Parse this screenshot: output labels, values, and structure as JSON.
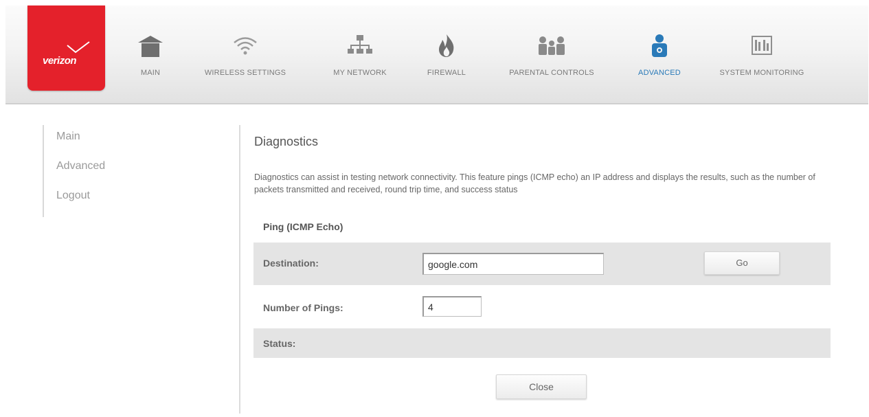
{
  "brand": {
    "logo_text": "verizon",
    "color": "#e4212b"
  },
  "nav": {
    "items": [
      {
        "label": "MAIN",
        "icon": "home-icon"
      },
      {
        "label": "WIRELESS SETTINGS",
        "icon": "wifi-icon"
      },
      {
        "label": "MY NETWORK",
        "icon": "network-icon"
      },
      {
        "label": "FIREWALL",
        "icon": "flame-icon"
      },
      {
        "label": "PARENTAL CONTROLS",
        "icon": "family-icon"
      },
      {
        "label": "ADVANCED",
        "icon": "advanced-user-icon",
        "active": true
      },
      {
        "label": "SYSTEM MONITORING",
        "icon": "monitor-icon"
      }
    ],
    "active_color": "#2a7ab8"
  },
  "sidebar": {
    "items": [
      {
        "label": "Main"
      },
      {
        "label": "Advanced"
      },
      {
        "label": "Logout"
      }
    ]
  },
  "content": {
    "title": "Diagnostics",
    "description": "Diagnostics can assist in testing network connectivity. This feature pings (ICMP echo) an IP address and displays the results, such as the number of packets transmitted and received, round trip time, and success status",
    "section_title": "Ping (ICMP Echo)",
    "destination_label": "Destination:",
    "destination_value": "google.com",
    "go_label": "Go",
    "pings_label": "Number of Pings:",
    "pings_value": "4",
    "status_label": "Status:",
    "close_label": "Close"
  }
}
